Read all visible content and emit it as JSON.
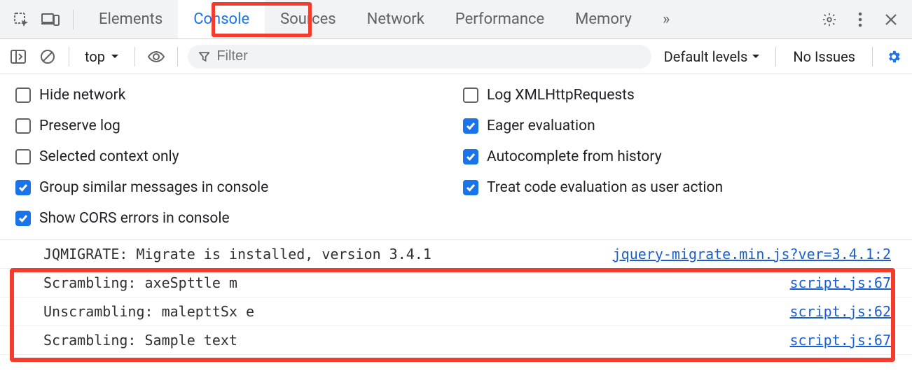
{
  "tabs": {
    "elements": "Elements",
    "console": "Console",
    "sources": "Sources",
    "network": "Network",
    "performance": "Performance",
    "memory": "Memory"
  },
  "filterbar": {
    "context": "top",
    "filter_placeholder": "Filter",
    "levels_label": "Default levels",
    "no_issues": "No Issues"
  },
  "settings": {
    "left": [
      {
        "label": "Hide network",
        "checked": false
      },
      {
        "label": "Preserve log",
        "checked": false
      },
      {
        "label": "Selected context only",
        "checked": false
      },
      {
        "label": "Group similar messages in console",
        "checked": true
      },
      {
        "label": "Show CORS errors in console",
        "checked": true
      }
    ],
    "right": [
      {
        "label": "Log XMLHttpRequests",
        "checked": false
      },
      {
        "label": "Eager evaluation",
        "checked": true
      },
      {
        "label": "Autocomplete from history",
        "checked": true
      },
      {
        "label": "Treat code evaluation as user action",
        "checked": true
      }
    ]
  },
  "console": [
    {
      "msg": "JQMIGRATE: Migrate is installed, version 3.4.1",
      "src": "jquery-migrate.min.js?ver=3.4.1:2"
    },
    {
      "msg": "Scrambling: axeSpttle m",
      "src": "script.js:67"
    },
    {
      "msg": "Unscrambling: malepttSx e",
      "src": "script.js:62"
    },
    {
      "msg": "Scrambling: Sample text",
      "src": "script.js:67"
    }
  ]
}
